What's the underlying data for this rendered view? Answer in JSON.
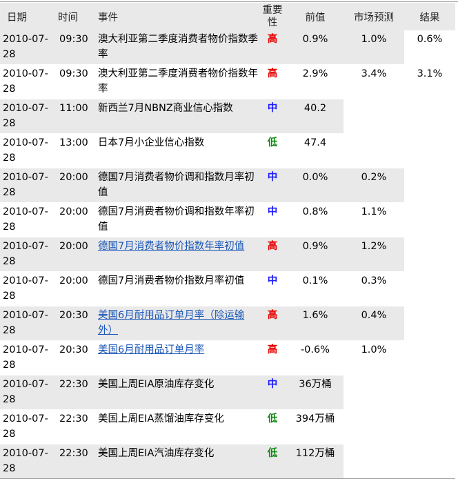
{
  "header": {
    "date": "日期",
    "time": "时间",
    "event": "事件",
    "importance_line1": "重要",
    "importance_line2": "性",
    "previous": "前值",
    "forecast": "市场预测",
    "result": "结果"
  },
  "rows": [
    {
      "date": "2010-07-28",
      "time": "09:30",
      "event": "澳大利亚第二季度消费者物价指数季率",
      "link": false,
      "importance": "高",
      "level": "high",
      "previous": "0.9%",
      "forecast": "1.0%",
      "result": "0.6%"
    },
    {
      "date": "2010-07-28",
      "time": "09:30",
      "event": "澳大利亚第二季度消费者物价指数年率",
      "link": false,
      "importance": "高",
      "level": "high",
      "previous": "2.9%",
      "forecast": "3.4%",
      "result": "3.1%"
    },
    {
      "date": "2010-07-28",
      "time": "11:00",
      "event": "新西兰7月NBNZ商业信心指数",
      "link": false,
      "importance": "中",
      "level": "medium",
      "previous": "40.2",
      "forecast": "",
      "result": ""
    },
    {
      "date": "2010-07-28",
      "time": "13:00",
      "event": "日本7月小企业信心指数",
      "link": false,
      "importance": "低",
      "level": "low",
      "previous": "47.4",
      "forecast": "",
      "result": ""
    },
    {
      "date": "2010-07-28",
      "time": "20:00",
      "event": "德国7月消费者物价调和指数月率初值",
      "link": false,
      "importance": "中",
      "level": "medium",
      "previous": "0.0%",
      "forecast": "0.2%",
      "result": ""
    },
    {
      "date": "2010-07-28",
      "time": "20:00",
      "event": "德国7月消费者物价调和指数年率初值",
      "link": false,
      "importance": "中",
      "level": "medium",
      "previous": "0.8%",
      "forecast": "1.1%",
      "result": ""
    },
    {
      "date": "2010-07-28",
      "time": "20:00",
      "event": "德国7月消费者物价指数年率初值",
      "link": true,
      "importance": "高",
      "level": "high",
      "previous": "0.9%",
      "forecast": "1.2%",
      "result": ""
    },
    {
      "date": "2010-07-28",
      "time": "20:00",
      "event": "德国7月消费者物价指数月率初值",
      "link": false,
      "importance": "中",
      "level": "medium",
      "previous": "0.1%",
      "forecast": "0.3%",
      "result": ""
    },
    {
      "date": "2010-07-28",
      "time": "20:30",
      "event": "美国6月耐用品订单月率（除运输外）",
      "link": true,
      "importance": "高",
      "level": "high",
      "previous": "1.6%",
      "forecast": "0.4%",
      "result": ""
    },
    {
      "date": "2010-07-28",
      "time": "20:30",
      "event": "美国6月耐用品订单月率",
      "link": true,
      "importance": "高",
      "level": "high",
      "previous": "-0.6%",
      "forecast": "1.0%",
      "result": ""
    },
    {
      "date": "2010-07-28",
      "time": "22:30",
      "event": "美国上周EIA原油库存变化",
      "link": false,
      "importance": "中",
      "level": "medium",
      "previous": "36万桶",
      "forecast": "",
      "result": ""
    },
    {
      "date": "2010-07-28",
      "time": "22:30",
      "event": "美国上周EIA蒸馏油库存变化",
      "link": false,
      "importance": "低",
      "level": "low",
      "previous": "394万桶",
      "forecast": "",
      "result": ""
    },
    {
      "date": "2010-07-28",
      "time": "22:30",
      "event": "美国上周EIA汽油库存变化",
      "link": false,
      "importance": "低",
      "level": "low",
      "previous": "112万桶",
      "forecast": "",
      "result": ""
    }
  ],
  "colors": {
    "high": "#e60000",
    "medium": "#1a1aff",
    "low": "#118811",
    "link": "#1a56b8",
    "shade": "#e9e9e9"
  }
}
